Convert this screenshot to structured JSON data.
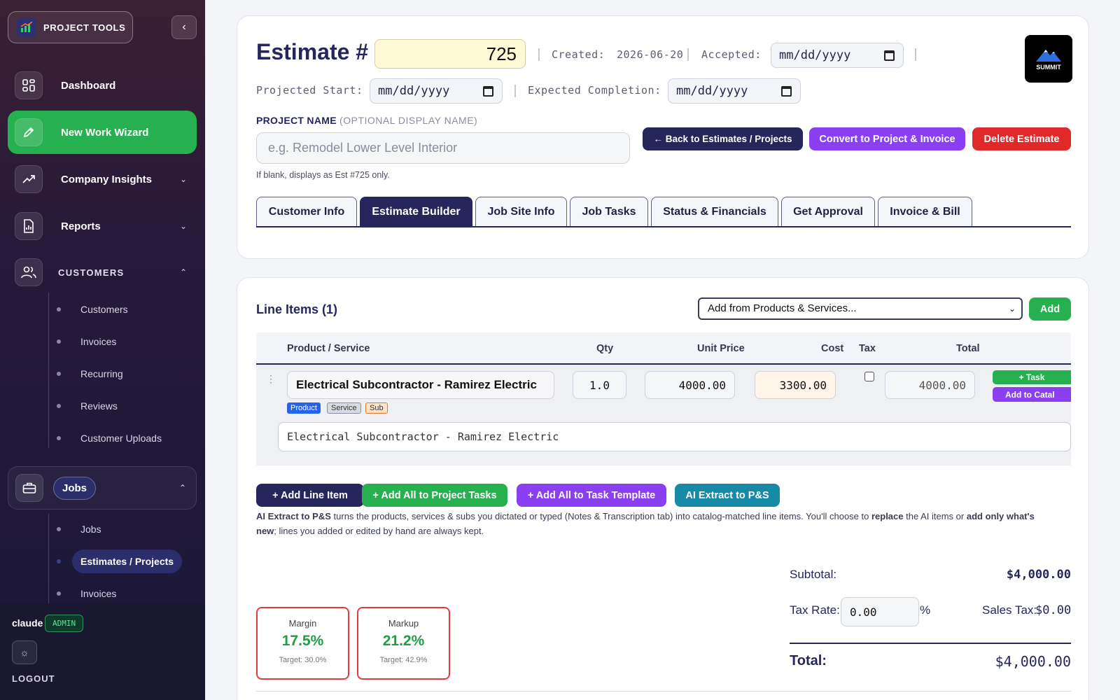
{
  "sidebar": {
    "brand": "PROJECT TOOLS",
    "nav": {
      "dashboard": "Dashboard",
      "new_work_wizard": "New Work Wizard",
      "company_insights": "Company Insights",
      "reports": "Reports",
      "customers_section": "CUSTOMERS"
    },
    "customers_items": [
      "Customers",
      "Invoices",
      "Recurring",
      "Reviews",
      "Customer Uploads"
    ],
    "jobs_group": "Jobs",
    "jobs_items": [
      "Jobs",
      "Estimates / Projects",
      "Invoices"
    ],
    "user": "claude",
    "role": "ADMIN",
    "logout": "LOGOUT"
  },
  "header": {
    "title": "Estimate #",
    "estimate_number": "725",
    "created_label": "Created:",
    "created_value": "2026-06-20",
    "accepted_label": "Accepted:",
    "date_placeholder": "mm/dd/yyyy",
    "projected_start_label": "Projected Start:",
    "expected_completion_label": "Expected Completion:",
    "logo_text": "SUMMIT"
  },
  "project_name": {
    "label": "PROJECT NAME",
    "sublabel": "(OPTIONAL DISPLAY NAME)",
    "placeholder": "e.g. Remodel Lower Level Interior",
    "help": "If blank, displays as Est #725 only."
  },
  "actions": {
    "back": "← Back to Estimates / Projects",
    "convert": "Convert to Project & Invoice",
    "delete": "Delete Estimate"
  },
  "tabs": [
    "Customer Info",
    "Estimate Builder",
    "Job Site Info",
    "Job Tasks",
    "Status & Financials",
    "Get Approval",
    "Invoice & Bill"
  ],
  "line_items": {
    "title": "Line Items (1)",
    "catalog_select": "Add from Products & Services...",
    "add_button": "Add",
    "columns": [
      "Product / Service",
      "Qty",
      "Unit Price",
      "Cost",
      "Tax",
      "Total"
    ],
    "rows": [
      {
        "name": "Electrical Subcontractor - Ramirez Electric",
        "types": [
          "Product",
          "Service",
          "Sub"
        ],
        "qty": "1.0",
        "unit_price": "4000.00",
        "cost": "3300.00",
        "tax": false,
        "total": "4000.00",
        "task_button": "+ Task",
        "catalog_button": "Add to Catal",
        "description": "Electrical Subcontractor - Ramirez Electric"
      }
    ]
  },
  "bulk_actions": {
    "add_line_item": "+ Add Line Item",
    "add_all_tasks": "+ Add All to Project Tasks",
    "add_all_template": "+ Add All to Task Template",
    "ai_extract": "AI Extract to P&S"
  },
  "ai_note": {
    "bold1": "AI Extract to P&S",
    "text1": " turns the products, services & subs you dictated or typed (Notes & Transcription tab) into catalog-matched line items. You'll choose to ",
    "bold2": "replace",
    "text2": " the AI items or ",
    "bold3": "add only what's new",
    "text3": "; lines you added or edited by hand are always kept."
  },
  "metrics": {
    "margin_label": "Margin",
    "margin_value": "17.5%",
    "margin_target": "Target: 30.0%",
    "markup_label": "Markup",
    "markup_value": "21.2%",
    "markup_target": "Target: 42.9%"
  },
  "totals": {
    "subtotal_label": "Subtotal:",
    "subtotal_value": "$4,000.00",
    "tax_rate_label": "Tax Rate:",
    "tax_rate_value": "0.00",
    "percent": "%",
    "sales_tax_label": "Sales Tax:",
    "sales_tax_value": "$0.00",
    "total_label": "Total:",
    "total_value": "$4,000.00"
  },
  "colors": {
    "accent_navy": "#26265c",
    "green": "#26b04f",
    "purple": "#8a3ff0",
    "red": "#e02a2a",
    "teal": "#168aa6"
  }
}
